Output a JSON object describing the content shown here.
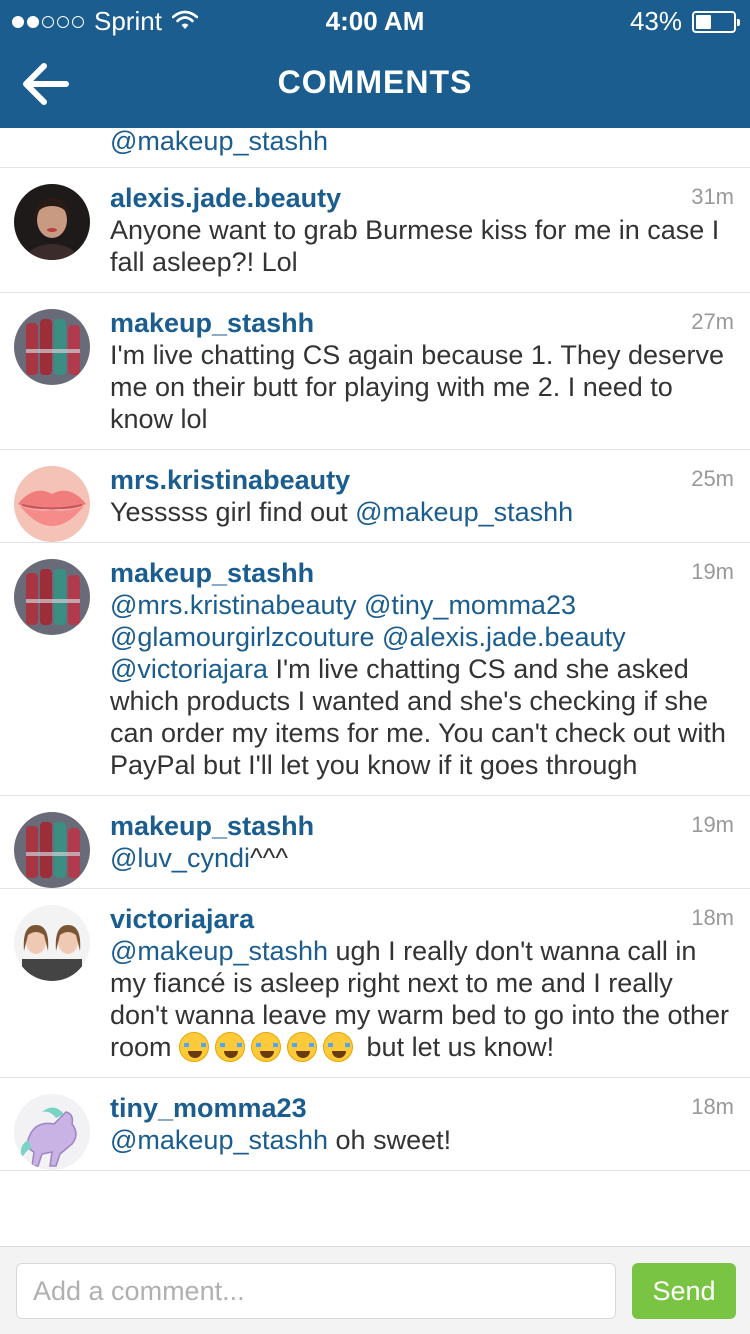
{
  "status_bar": {
    "carrier": "Sprint",
    "time": "4:00 AM",
    "battery": "43%",
    "battery_level": 0.43,
    "signal_dots_filled": 2,
    "signal_dots_total": 5
  },
  "nav": {
    "title": "COMMENTS",
    "back_icon": "back-arrow-icon"
  },
  "partial_top_text": "@makeup_stashh",
  "comments": [
    {
      "user": "alexis.jade.beauty",
      "time": "31m",
      "parts": [
        {
          "t": "Anyone want to grab Burmese kiss for me in case I fall asleep?! Lol",
          "m": false
        }
      ]
    },
    {
      "user": "makeup_stashh",
      "time": "27m",
      "parts": [
        {
          "t": "I'm live chatting CS again because 1. They deserve me on their butt for playing with me 2. I need to know lol",
          "m": false
        }
      ]
    },
    {
      "user": "mrs.kristinabeauty",
      "time": "25m",
      "parts": [
        {
          "t": "Yesssss girl find out ",
          "m": false
        },
        {
          "t": "@makeup_stashh",
          "m": true
        }
      ]
    },
    {
      "user": "makeup_stashh",
      "time": "19m",
      "parts": [
        {
          "t": "@mrs.kristinabeauty",
          "m": true
        },
        {
          "t": " ",
          "m": false
        },
        {
          "t": "@tiny_momma23",
          "m": true
        },
        {
          "t": " ",
          "m": false
        },
        {
          "t": "@glamourgirlzcouture",
          "m": true
        },
        {
          "t": " ",
          "m": false
        },
        {
          "t": "@alexis.jade.beauty",
          "m": true
        },
        {
          "t": " ",
          "m": false
        },
        {
          "t": "@victoriajara",
          "m": true
        },
        {
          "t": " I'm live chatting CS and she asked which products I wanted and she's checking if she can order my items for me. You can't check out with PayPal but I'll let you know if it goes through",
          "m": false
        }
      ]
    },
    {
      "user": "makeup_stashh",
      "time": "19m",
      "parts": [
        {
          "t": "@luv_cyndi",
          "m": true
        },
        {
          "t": "^^^",
          "m": false
        }
      ]
    },
    {
      "user": "victoriajara",
      "time": "18m",
      "parts": [
        {
          "t": "@makeup_stashh",
          "m": true
        },
        {
          "t": " ugh I really don't wanna call in my fiancé is asleep right next to me and I really don't wanna leave my warm bed  to go into the other room ",
          "m": false
        },
        {
          "emoji": "loudly-crying-face-emoji",
          "count": 5
        },
        {
          "t": " but let us know!",
          "m": false
        }
      ]
    },
    {
      "user": "tiny_momma23",
      "time": "18m",
      "parts": [
        {
          "t": "@makeup_stashh",
          "m": true
        },
        {
          "t": " oh sweet!",
          "m": false
        }
      ]
    }
  ],
  "input": {
    "placeholder": "Add a comment...",
    "value": "",
    "send_label": "Send"
  },
  "colors": {
    "header": "#1a5d8e",
    "link": "#1a5d8e",
    "send": "#79c442",
    "timestamp": "#999999"
  }
}
